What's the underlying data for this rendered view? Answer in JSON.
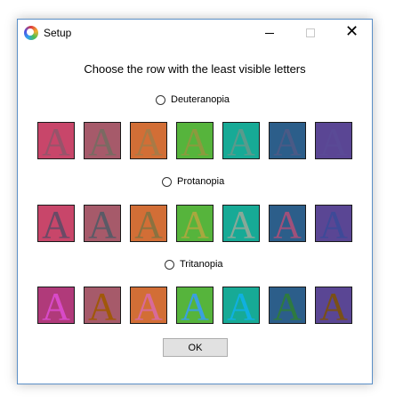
{
  "window": {
    "title": "Setup",
    "close_glyph": "✕"
  },
  "prompt": "Choose the row with the least visible letters",
  "letter": "A",
  "options": [
    {
      "label": "Deuteranopia",
      "swatches": [
        {
          "bg": "#c8466a",
          "fg": "#96546a"
        },
        {
          "bg": "#a65a6a",
          "fg": "#7a6a62"
        },
        {
          "bg": "#d26e36",
          "fg": "#a87a46"
        },
        {
          "bg": "#56b43c",
          "fg": "#8c9a3e"
        },
        {
          "bg": "#17aa96",
          "fg": "#5a9a8c"
        },
        {
          "bg": "#2c5e8a",
          "fg": "#4a5a86"
        },
        {
          "bg": "#5a4694",
          "fg": "#5a4a96"
        }
      ]
    },
    {
      "label": "Protanopia",
      "swatches": [
        {
          "bg": "#c8466a",
          "fg": "#6a4a66"
        },
        {
          "bg": "#a65a6a",
          "fg": "#5a5a66"
        },
        {
          "bg": "#d26e36",
          "fg": "#8a7240"
        },
        {
          "bg": "#56b43c",
          "fg": "#a8a83e"
        },
        {
          "bg": "#17aa96",
          "fg": "#88a898"
        },
        {
          "bg": "#2c5e8a",
          "fg": "#a0507a"
        },
        {
          "bg": "#5a4694",
          "fg": "#3e4a98"
        }
      ]
    },
    {
      "label": "Tritanopia",
      "swatches": [
        {
          "bg": "#b03a7a",
          "fg": "#d84ac8"
        },
        {
          "bg": "#a65a6a",
          "fg": "#a0580a"
        },
        {
          "bg": "#d26e36",
          "fg": "#d86a9a"
        },
        {
          "bg": "#56b43c",
          "fg": "#3aa0e0"
        },
        {
          "bg": "#17aa96",
          "fg": "#10b0e0"
        },
        {
          "bg": "#2c5e8a",
          "fg": "#2e7a40"
        },
        {
          "bg": "#5a4694",
          "fg": "#7a5016"
        }
      ]
    }
  ],
  "ok_label": "OK"
}
